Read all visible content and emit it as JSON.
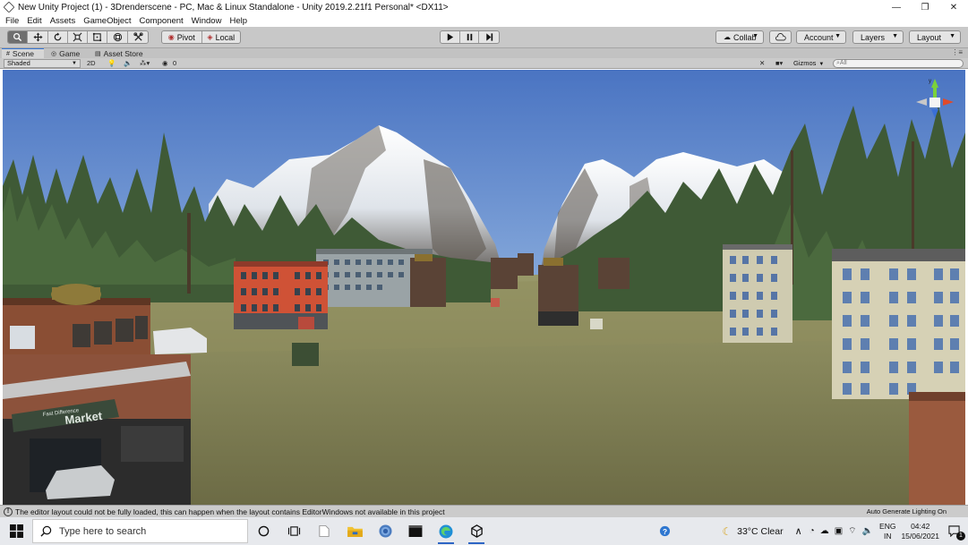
{
  "window": {
    "title": "New Unity Project (1) - 3Drenderscene - PC, Mac & Linux Standalone - Unity 2019.2.21f1 Personal* <DX11>",
    "minimize": "—",
    "maximize": "❐",
    "close": "✕"
  },
  "menu": [
    "File",
    "Edit",
    "Assets",
    "GameObject",
    "Component",
    "Window",
    "Help"
  ],
  "toolbar": {
    "pivot": "Pivot",
    "local": "Local",
    "collab": "Collab",
    "account": "Account",
    "layers": "Layers",
    "layout": "Layout"
  },
  "tabs": {
    "scene": "Scene",
    "game": "Game",
    "asset_store": "Asset Store"
  },
  "scene_toolbar": {
    "shading": "Shaded",
    "mode_2d": "2D",
    "hidden_count": "0",
    "gizmos": "Gizmos",
    "search_placeholder": "All"
  },
  "viewport": {
    "market_sign": "Market",
    "market_sign_small": "Fast Difference"
  },
  "status": {
    "message": "The editor layout could not be fully loaded, this can happen when the layout contains EditorWindows not available in this project",
    "right": "Auto Generate Lighting On"
  },
  "taskbar": {
    "search_placeholder": "Type here to search",
    "weather": "33°C  Clear",
    "lang_top": "ENG",
    "lang_bottom": "IN",
    "time": "04:42",
    "date": "15/06/2021",
    "notif_count": "1"
  },
  "colors": {
    "accent": "#3a79d6",
    "sky_top": "#4d79c6",
    "sky_bottom": "#c7dbf0",
    "ground": "#7d7a4f"
  }
}
